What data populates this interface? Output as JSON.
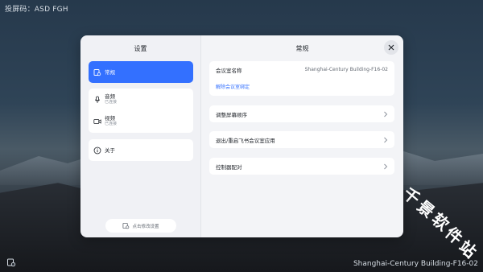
{
  "screen": {
    "cast_code": "投屏码：ASD FGH",
    "room_name_footer": "Shanghai-Century Building-F16-02"
  },
  "watermark": {
    "chars": [
      "千",
      "景",
      "软",
      "件",
      "站"
    ]
  },
  "left_panel": {
    "title": "设置",
    "items": [
      {
        "label": "常规",
        "sub": "",
        "icon": "settings-icon",
        "active": true
      },
      {
        "label": "音频",
        "sub": "已连接",
        "icon": "microphone-icon",
        "active": false
      },
      {
        "label": "视频",
        "sub": "已连接",
        "icon": "camera-icon",
        "active": false
      },
      {
        "label": "关于",
        "sub": "",
        "icon": "info-icon",
        "active": false
      }
    ],
    "edit_button": "点击修改设置"
  },
  "right_panel": {
    "title": "常规",
    "room_name_label": "会议室名称",
    "room_name_value": "Shanghai-Century Building-F16-02",
    "unbind_link": "解除会议室绑定",
    "rows": [
      {
        "label": "调整屏幕顺序"
      },
      {
        "label": "退出/重启飞书会议室应用"
      },
      {
        "label": "控制器配对"
      }
    ]
  },
  "colors": {
    "accent": "#3370ff",
    "panel_bg": "#f3f4f7",
    "text": "#1f2329"
  }
}
